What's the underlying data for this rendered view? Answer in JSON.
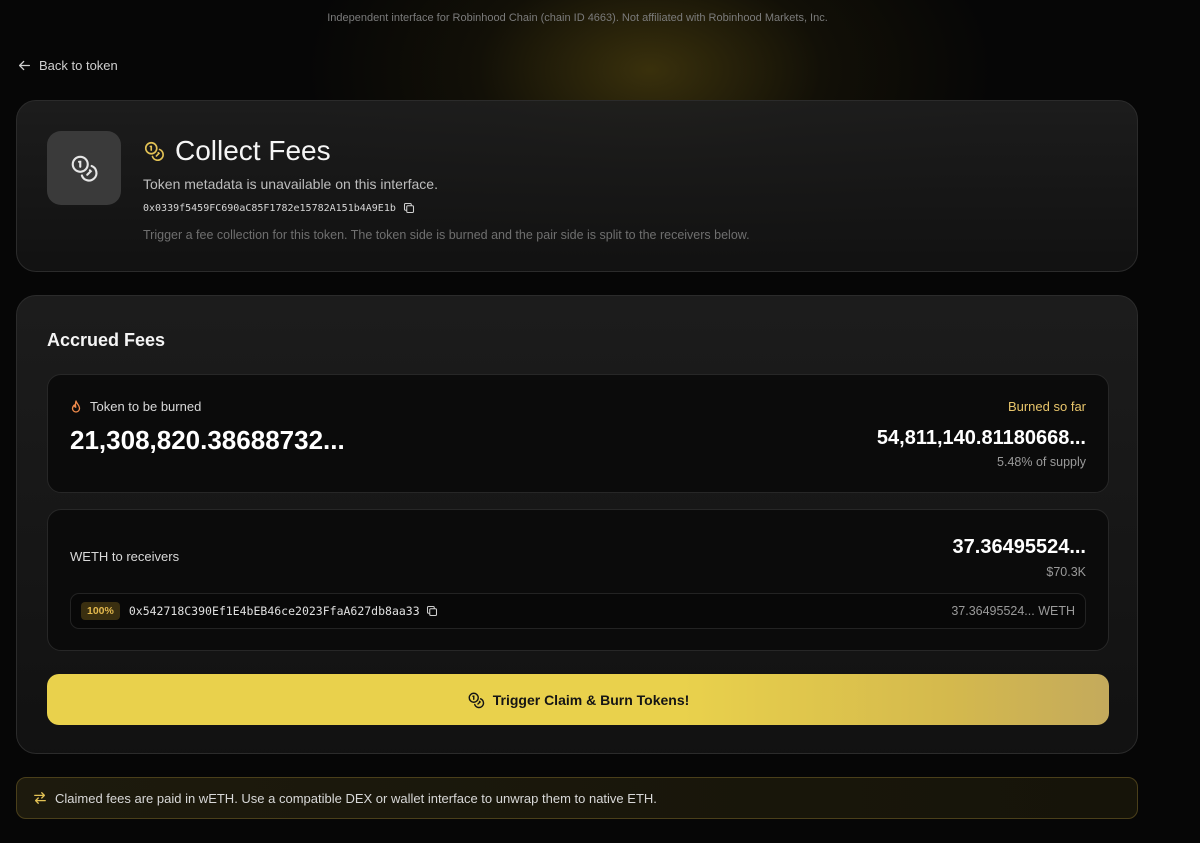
{
  "disclaimer": "Independent interface for Robinhood Chain (chain ID 4663). Not affiliated with Robinhood Markets, Inc.",
  "nav": {
    "back_label": "Back to token"
  },
  "header": {
    "title": "Collect Fees",
    "metadata_message": "Token metadata is unavailable on this interface.",
    "token_address": "0x0339f5459FC690aC85F1782e15782A151b4A9E1b",
    "description": "Trigger a fee collection for this token. The token side is burned and the pair side is split to the receivers below."
  },
  "fees": {
    "section_title": "Accrued Fees",
    "burn": {
      "label": "Token to be burned",
      "amount": "21,308,820.38688732...",
      "burned_label": "Burned so far",
      "burned_amount": "54,811,140.81180668...",
      "burned_percent": "5.48% of supply"
    },
    "weth": {
      "label": "WETH to receivers",
      "amount": "37.36495524...",
      "usd_value": "$70.3K",
      "receivers": [
        {
          "share": "100%",
          "address": "0x542718C390Ef1E4bEB46ce2023FfaA627db8aa33",
          "amount": "37.36495524... WETH"
        }
      ]
    },
    "cta_label": "Trigger Claim & Burn Tokens!"
  },
  "notice": "Claimed fees are paid in wETH. Use a compatible DEX or wallet interface to unwrap them to native ETH.",
  "colors": {
    "accent": "#e9d14c",
    "gold_text": "#e8c56b",
    "background": "#060606"
  }
}
